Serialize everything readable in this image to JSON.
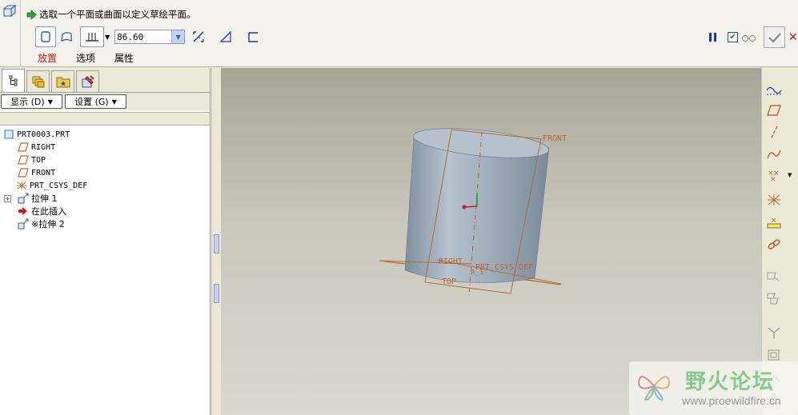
{
  "dashboard": {
    "prompt": "选取一个平面或曲面以定义草绘平面。",
    "depth_value": "86.60",
    "tabs": [
      {
        "label": "放置",
        "active": true
      },
      {
        "label": "选项",
        "active": false
      },
      {
        "label": "属性",
        "active": false
      }
    ]
  },
  "left_panel": {
    "show_button": "显示 (D)",
    "settings_button": "设置 (G)",
    "tree": [
      {
        "label": "PRT0003.PRT",
        "icon": "part-icon",
        "level": 0
      },
      {
        "label": "RIGHT",
        "icon": "datum-plane-icon",
        "level": 1
      },
      {
        "label": "TOP",
        "icon": "datum-plane-icon",
        "level": 1
      },
      {
        "label": "FRONT",
        "icon": "datum-plane-icon",
        "level": 1
      },
      {
        "label": "PRT_CSYS_DEF",
        "icon": "csys-icon",
        "level": 1
      },
      {
        "label": "拉伸 1",
        "icon": "extrude-icon",
        "level": 1,
        "expandable": true
      },
      {
        "label": "在此插入",
        "icon": "insert-arrow-icon",
        "level": 1
      },
      {
        "label": "※拉伸 2",
        "icon": "extrude-icon",
        "level": 1
      }
    ]
  },
  "viewport": {
    "labels": {
      "front": "FRONT",
      "right": "RIGHT",
      "top": "TOP",
      "csys": "PRT_CSYS_DEF",
      "axis": "A_1"
    }
  },
  "watermark": {
    "title": "野火论坛",
    "url": "www.proewildfire.cn"
  },
  "colors": {
    "accent_tab": "#c0201e",
    "datum": "#b8692a",
    "model": "#98a8b8"
  }
}
